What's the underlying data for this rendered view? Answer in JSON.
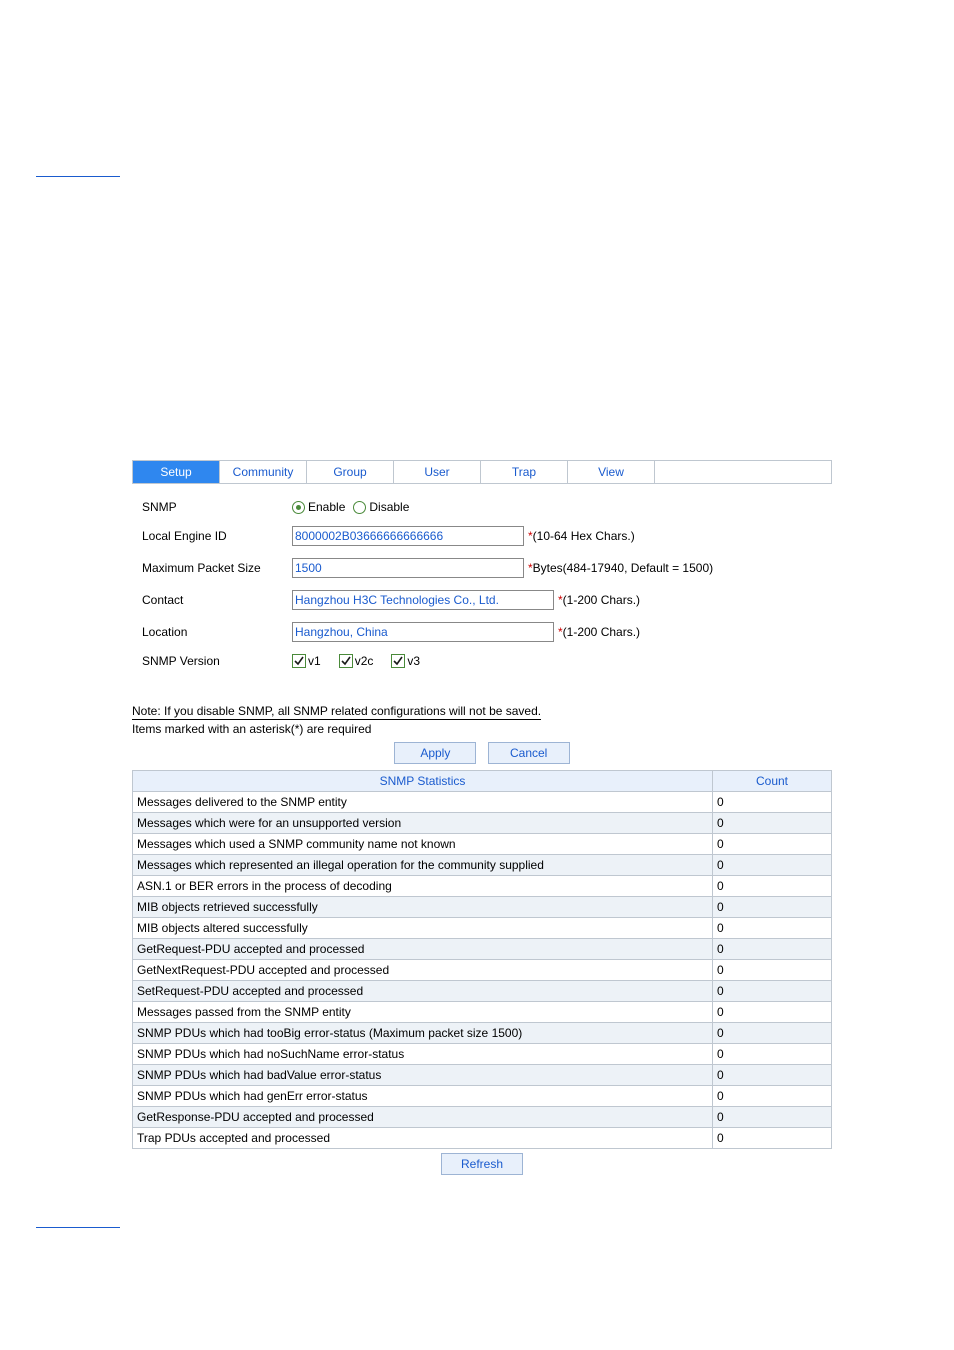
{
  "tabs": [
    {
      "label": "Setup",
      "active": true
    },
    {
      "label": "Community",
      "active": false
    },
    {
      "label": "Group",
      "active": false
    },
    {
      "label": "User",
      "active": false
    },
    {
      "label": "Trap",
      "active": false
    },
    {
      "label": "View",
      "active": false
    }
  ],
  "form": {
    "snmp_label": "SNMP",
    "enable_label": "Enable",
    "disable_label": "Disable",
    "snmp_enabled": true,
    "engine_label": "Local Engine ID",
    "engine_value": "8000002B03666666666666",
    "engine_hint": "(10-64 Hex Chars.)",
    "mps_label": "Maximum Packet Size",
    "mps_value": "1500",
    "mps_hint": "Bytes(484-17940, Default = 1500)",
    "contact_label": "Contact",
    "contact_value": "Hangzhou H3C Technologies Co., Ltd.",
    "contact_hint": "(1-200 Chars.)",
    "location_label": "Location",
    "location_value": "Hangzhou, China",
    "location_hint": "(1-200 Chars.)",
    "version_label": "SNMP Version",
    "v1_label": "v1",
    "v2c_label": "v2c",
    "v3_label": "v3",
    "v1": true,
    "v2c": true,
    "v3": true
  },
  "notes": {
    "disable_note": "Note: If you disable SNMP, all SNMP related configurations will not be saved.",
    "required_note": "Items marked with an asterisk(*) are required"
  },
  "buttons": {
    "apply": "Apply",
    "cancel": "Cancel",
    "refresh": "Refresh"
  },
  "stats_header": {
    "col1": "SNMP Statistics",
    "col2": "Count"
  },
  "stats": [
    {
      "label": "Messages delivered to the SNMP entity",
      "count": "0"
    },
    {
      "label": "Messages which were for an unsupported version",
      "count": "0"
    },
    {
      "label": "Messages which used a SNMP community name not known",
      "count": "0"
    },
    {
      "label": "Messages which represented an illegal operation for the community supplied",
      "count": "0"
    },
    {
      "label": "ASN.1 or BER errors in the process of decoding",
      "count": "0"
    },
    {
      "label": "MIB objects retrieved successfully",
      "count": "0"
    },
    {
      "label": "MIB objects altered successfully",
      "count": "0"
    },
    {
      "label": "GetRequest-PDU accepted and processed",
      "count": "0"
    },
    {
      "label": "GetNextRequest-PDU accepted and processed",
      "count": "0"
    },
    {
      "label": "SetRequest-PDU accepted and processed",
      "count": "0"
    },
    {
      "label": "Messages passed from the SNMP entity",
      "count": "0"
    },
    {
      "label": "SNMP PDUs which had tooBig error-status (Maximum packet size 1500)",
      "count": "0"
    },
    {
      "label": "SNMP PDUs which had noSuchName error-status",
      "count": "0"
    },
    {
      "label": "SNMP PDUs which had badValue error-status",
      "count": "0"
    },
    {
      "label": "SNMP PDUs which had genErr error-status",
      "count": "0"
    },
    {
      "label": "GetResponse-PDU accepted and processed",
      "count": "0"
    },
    {
      "label": "Trap PDUs accepted and processed",
      "count": "0"
    }
  ]
}
